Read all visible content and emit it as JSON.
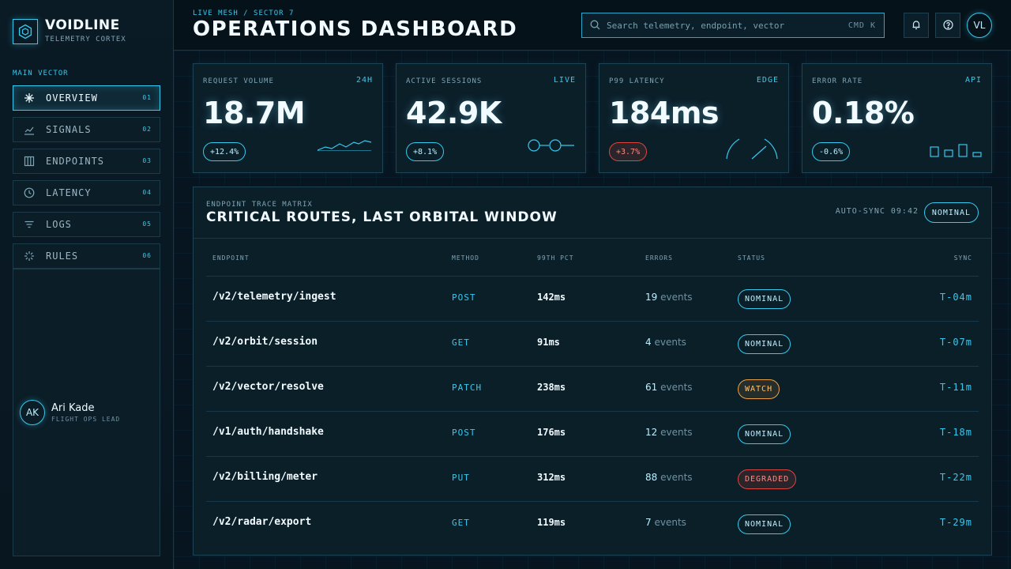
{
  "brand": {
    "name": "VOIDLINE",
    "subtitle": "TELEMETRY CORTEX"
  },
  "nav": {
    "title": "MAIN VECTOR",
    "items": [
      {
        "label": "OVERVIEW",
        "num": "01",
        "icon": "sparkle-icon",
        "active": true
      },
      {
        "label": "SIGNALS",
        "num": "02",
        "icon": "chart-line-icon"
      },
      {
        "label": "ENDPOINTS",
        "num": "03",
        "icon": "columns-icon"
      },
      {
        "label": "LATENCY",
        "num": "04",
        "icon": "clock-icon"
      },
      {
        "label": "LOGS",
        "num": "05",
        "icon": "filter-lines-icon"
      },
      {
        "label": "RULES",
        "num": "06",
        "icon": "burst-icon"
      }
    ]
  },
  "user": {
    "initials": "AK",
    "name": "Ari Kade",
    "role": "FLIGHT OPS LEAD"
  },
  "header": {
    "crumb": "LIVE MESH / SECTOR 7",
    "title": "OPERATIONS DASHBOARD",
    "search_placeholder": "Search telemetry, endpoint, vector",
    "search_shortcut": "CMD K",
    "avatar_initials": "VL"
  },
  "kpis": [
    {
      "label": "REQUEST VOLUME",
      "tag": "24H",
      "value": "18.7M",
      "delta": "+12.4%",
      "trend": "up"
    },
    {
      "label": "ACTIVE SESSIONS",
      "tag": "LIVE",
      "value": "42.9K",
      "delta": "+8.1%",
      "trend": "up"
    },
    {
      "label": "P99 LATENCY",
      "tag": "EDGE",
      "value": "184ms",
      "delta": "+3.7%",
      "trend": "bad"
    },
    {
      "label": "ERROR RATE",
      "tag": "API",
      "value": "0.18%",
      "delta": "-0.6%",
      "trend": "up"
    }
  ],
  "table": {
    "subtitle": "ENDPOINT TRACE MATRIX",
    "title": "CRITICAL ROUTES, LAST ORBITAL WINDOW",
    "sync_text": "AUTO-SYNC 09:42",
    "status": "NOMINAL",
    "columns": {
      "endpoint": "ENDPOINT",
      "method": "METHOD",
      "p99": "99TH PCT",
      "errors": "ERRORS",
      "status": "STATUS",
      "sync": "SYNC"
    },
    "rows": [
      {
        "endpoint": "/v2/telemetry/ingest",
        "method": "POST",
        "p99": "142ms",
        "errors": "19",
        "errors_unit": "events",
        "status": "NOMINAL",
        "sync": "T-04m"
      },
      {
        "endpoint": "/v2/orbit/session",
        "method": "GET",
        "p99": "91ms",
        "errors": "4",
        "errors_unit": "events",
        "status": "NOMINAL",
        "sync": "T-07m"
      },
      {
        "endpoint": "/v2/vector/resolve",
        "method": "PATCH",
        "p99": "238ms",
        "errors": "61",
        "errors_unit": "events",
        "status": "WATCH",
        "sync": "T-11m"
      },
      {
        "endpoint": "/v1/auth/handshake",
        "method": "POST",
        "p99": "176ms",
        "errors": "12",
        "errors_unit": "events",
        "status": "NOMINAL",
        "sync": "T-18m"
      },
      {
        "endpoint": "/v2/billing/meter",
        "method": "PUT",
        "p99": "312ms",
        "errors": "88",
        "errors_unit": "events",
        "status": "DEGRADED",
        "sync": "T-22m"
      },
      {
        "endpoint": "/v2/radar/export",
        "method": "GET",
        "p99": "119ms",
        "errors": "7",
        "errors_unit": "events",
        "status": "NOMINAL",
        "sync": "T-29m"
      }
    ]
  },
  "colors": {
    "accent": "#36c9ee",
    "background": "#06121a",
    "warning": "#f0a040",
    "danger": "#e0443f"
  }
}
